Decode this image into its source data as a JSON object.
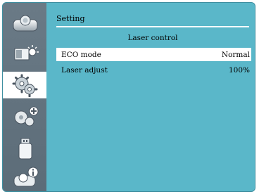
{
  "menu": {
    "title": "Setting",
    "subheader": "Laser control"
  },
  "rows": [
    {
      "label": "ECO  mode",
      "value": "Normal"
    },
    {
      "label": "Laser adjust",
      "value": "100%"
    }
  ],
  "sidebar": {
    "items": [
      {
        "icon": "projector-icon"
      },
      {
        "icon": "picture-adjust-icon"
      },
      {
        "icon": "settings-gears-icon",
        "selected": true
      },
      {
        "icon": "expanded-settings-icon"
      },
      {
        "icon": "usb-icon"
      },
      {
        "icon": "info-icon"
      }
    ]
  },
  "colors": {
    "background": "#5ab7c9",
    "sidebar": "#64747f",
    "highlight": "#ffffff"
  }
}
